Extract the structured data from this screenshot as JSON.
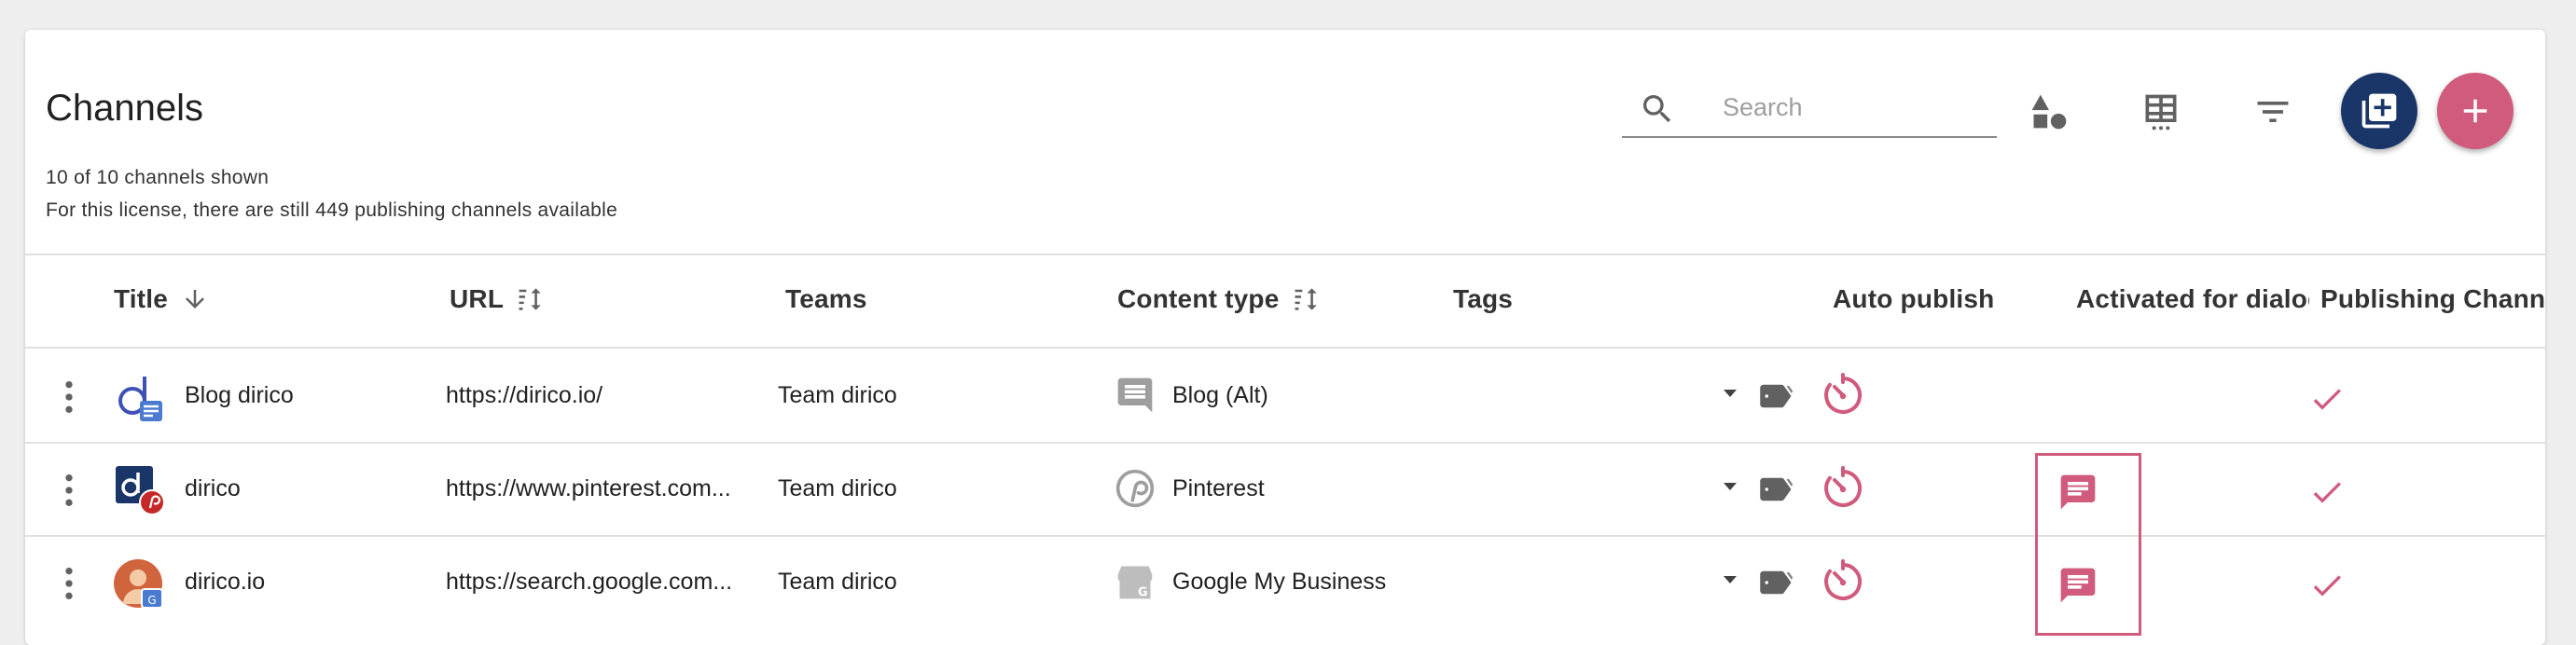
{
  "header": {
    "title": "Channels",
    "shown_count": "10 of 10 channels shown",
    "license_note": "For this license, there are still 449 publishing channels available",
    "search_placeholder": "Search",
    "search_value": ""
  },
  "toolbar": {
    "icons": [
      "shapes-icon",
      "table-view-icon",
      "filter-icon",
      "add-box-icon",
      "add-icon"
    ]
  },
  "table": {
    "columns": {
      "title": "Title",
      "url": "URL",
      "teams": "Teams",
      "content_type": "Content type",
      "tags": "Tags",
      "auto_publish": "Auto publish",
      "activated_for_dialog": "Activated for dialog",
      "publishing_channel": "Publishing Channel"
    },
    "rows": [
      {
        "title": "Blog dirico",
        "url": "https://dirico.io/",
        "team": "Team dirico",
        "content_type": "Blog (Alt)",
        "content_icon": "comment-icon",
        "dialog_active": false,
        "publishing": true
      },
      {
        "title": "dirico",
        "url": "https://www.pinterest.com...",
        "team": "Team dirico",
        "content_type": "Pinterest",
        "content_icon": "pinterest-icon",
        "dialog_active": true,
        "publishing": true
      },
      {
        "title": "dirico.io",
        "url": "https://search.google.com...",
        "team": "Team dirico",
        "content_type": "Google My Business",
        "content_icon": "google-my-business-icon",
        "dialog_active": true,
        "publishing": true
      }
    ]
  },
  "colors": {
    "primary": "#1a3668",
    "accent": "#d05b7c",
    "text": "#212121",
    "muted": "#9e9e9e"
  }
}
